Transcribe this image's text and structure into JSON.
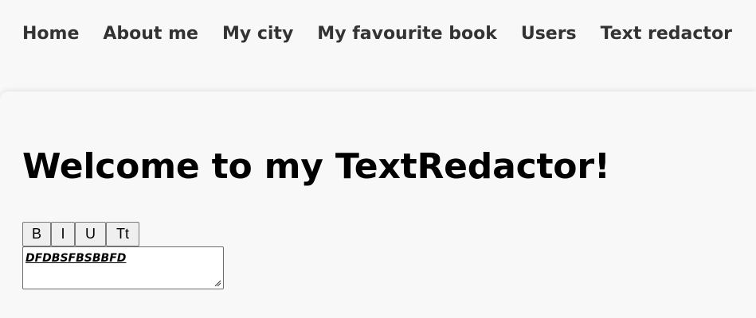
{
  "nav": {
    "items": [
      {
        "label": "Home"
      },
      {
        "label": "About me"
      },
      {
        "label": "My city"
      },
      {
        "label": "My favourite book"
      },
      {
        "label": "Users"
      },
      {
        "label": "Text redactor"
      }
    ]
  },
  "main": {
    "title": "Welcome to my TextRedactor!"
  },
  "toolbar": {
    "bold_label": "B",
    "italic_label": "I",
    "underline_label": "U",
    "textsize_label": "Tt"
  },
  "editor": {
    "value": "DFDBSFBSBBFD"
  },
  "icons": {
    "resize_grip": "resize-grip-icon"
  }
}
